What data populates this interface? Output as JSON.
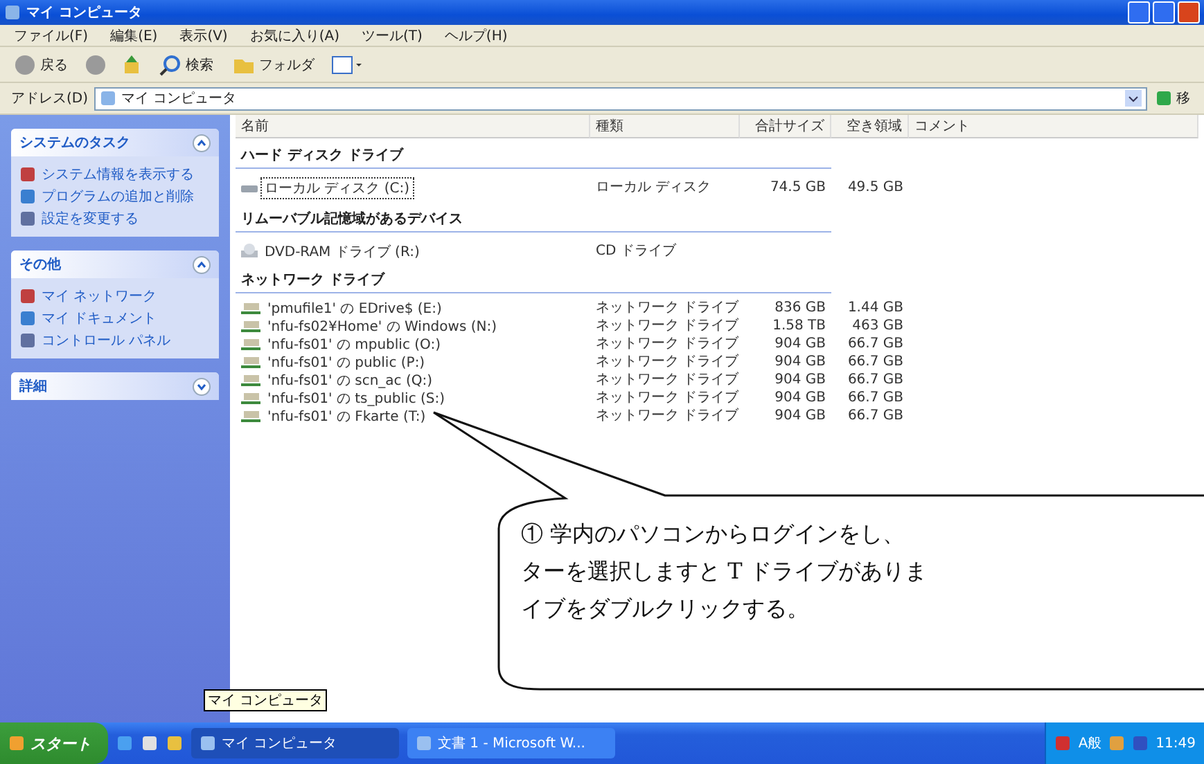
{
  "window": {
    "title": "マイ コンピュータ"
  },
  "menu": [
    "ファイル(F)",
    "編集(E)",
    "表示(V)",
    "お気に入り(A)",
    "ツール(T)",
    "ヘルプ(H)"
  ],
  "toolbar": {
    "back": "戻る",
    "search": "検索",
    "folders": "フォルダ"
  },
  "address": {
    "label": "アドレス(D)",
    "value": "マイ コンピュータ",
    "go": "移"
  },
  "sidebar": [
    {
      "title": "システムのタスク",
      "expanded": true,
      "items": [
        "システム情報を表示する",
        "プログラムの追加と削除",
        "設定を変更する"
      ]
    },
    {
      "title": "その他",
      "expanded": true,
      "items": [
        "マイ ネットワーク",
        "マイ ドキュメント",
        "コントロール パネル"
      ]
    },
    {
      "title": "詳細",
      "expanded": false
    }
  ],
  "table": {
    "columns": [
      "名前",
      "種類",
      "合計サイズ",
      "空き領域",
      "コメント"
    ],
    "groups": [
      {
        "title": "ハード ディスク ドライブ",
        "rows": [
          {
            "kind": "disk",
            "name": "ローカル ディスク (C:)",
            "type": "ローカル ディスク",
            "size": "74.5 GB",
            "free": "49.5 GB",
            "selected": true
          }
        ]
      },
      {
        "title": "リムーバブル記憶域があるデバイス",
        "rows": [
          {
            "kind": "cd",
            "name": "DVD-RAM ドライブ (R:)",
            "type": "CD ドライブ",
            "selected": false
          }
        ]
      },
      {
        "title": "ネットワーク ドライブ",
        "rows": [
          {
            "kind": "net",
            "name": "'pmufile1' の EDrive$ (E:)",
            "type": "ネットワーク ドライブ",
            "size": "836 GB",
            "free": "1.44 GB",
            "selected": false
          },
          {
            "kind": "net",
            "name": "'nfu-fs02¥Home' の Windows (N:)",
            "type": "ネットワーク ドライブ",
            "size": "1.58 TB",
            "free": "463 GB",
            "selected": false
          },
          {
            "kind": "net",
            "name": "'nfu-fs01' の mpublic (O:)",
            "type": "ネットワーク ドライブ",
            "size": "904 GB",
            "free": "66.7 GB",
            "selected": false
          },
          {
            "kind": "net",
            "name": "'nfu-fs01' の public (P:)",
            "type": "ネットワーク ドライブ",
            "size": "904 GB",
            "free": "66.7 GB",
            "selected": false
          },
          {
            "kind": "net",
            "name": "'nfu-fs01' の scn_ac (Q:)",
            "type": "ネットワーク ドライブ",
            "size": "904 GB",
            "free": "66.7 GB",
            "selected": false
          },
          {
            "kind": "net",
            "name": "'nfu-fs01' の ts_public (S:)",
            "type": "ネットワーク ドライブ",
            "size": "904 GB",
            "free": "66.7 GB",
            "selected": false
          },
          {
            "kind": "net",
            "name": "'nfu-fs01' の Fkarte (T:)",
            "type": "ネットワーク ドライブ",
            "size": "904 GB",
            "free": "66.7 GB",
            "selected": false
          }
        ]
      }
    ]
  },
  "callout": {
    "lines": [
      "① 学内のパソコンからログインをし、",
      "ターを選択しますと T ドライブがありま",
      "イブをダブルクリックする。"
    ]
  },
  "tooltip": "マイ コンピュータ",
  "taskbar": {
    "start": "スタート",
    "tasks": [
      {
        "label": "マイ コンピュータ",
        "selected": true
      },
      {
        "label": "文書 1 - Microsoft W...",
        "selected": false
      }
    ],
    "ime": "A般",
    "clock": "11:49"
  }
}
